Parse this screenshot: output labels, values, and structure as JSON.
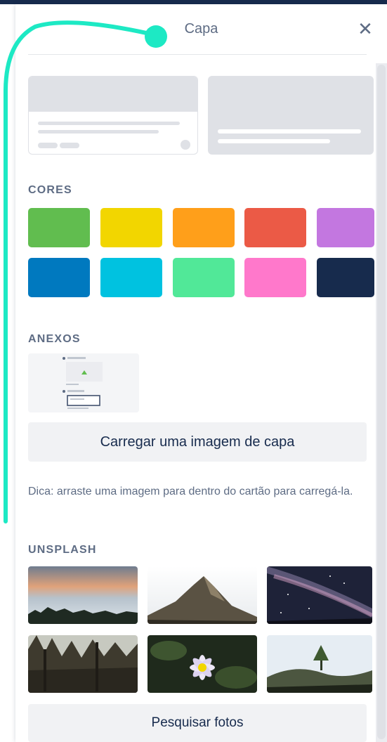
{
  "header": {
    "title": "Capa",
    "close_icon": "close-icon"
  },
  "sections": {
    "colors_label": "CORES",
    "attachments_label": "ANEXOS",
    "unsplash_label": "UNSPLASH"
  },
  "colors": [
    "#61bd4f",
    "#f2d600",
    "#ff9f1a",
    "#eb5a46",
    "#c377e0",
    "#0079bf",
    "#00c2e0",
    "#51e898",
    "#ff78cb",
    "#172b4d"
  ],
  "upload_button": "Carregar uma imagem de capa",
  "hint": "Dica: arraste uma imagem para dentro do cartão para carregá-la.",
  "search_button": "Pesquisar fotos",
  "annotation_color": "#1de9c4"
}
